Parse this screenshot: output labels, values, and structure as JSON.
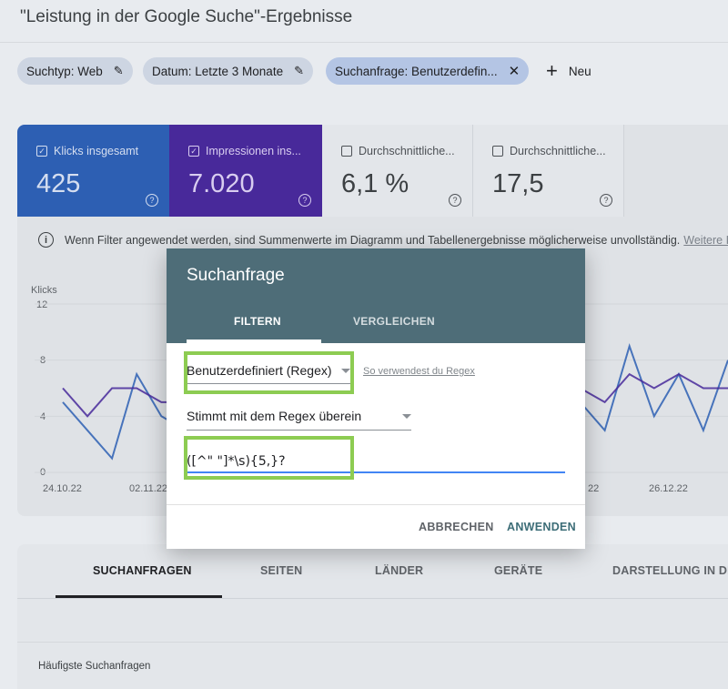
{
  "page": {
    "title": "\"Leistung in der Google Suche\"-Ergebnisse"
  },
  "filters": {
    "chips": [
      {
        "label": "Suchtyp: Web"
      },
      {
        "label": "Datum: Letzte 3 Monate"
      },
      {
        "label": "Suchanfrage: Benutzerdefin..."
      }
    ],
    "new_label": "Neu"
  },
  "metrics": [
    {
      "label": "Klicks insgesamt",
      "value": "425",
      "checked": true,
      "color": "#2d5fb3"
    },
    {
      "label": "Impressionen ins...",
      "value": "7.020",
      "checked": true,
      "color": "#48299a"
    },
    {
      "label": "Durchschnittliche...",
      "value": "6,1 %",
      "checked": false
    },
    {
      "label": "Durchschnittliche...",
      "value": "17,5",
      "checked": false
    }
  ],
  "info": {
    "text": "Wenn Filter angewendet werden, sind Summenwerte im Diagramm und Tabellenergebnisse möglicherweise unvollständig.",
    "link": "Weitere Inform"
  },
  "chart": {
    "ylabel": "Klicks",
    "yticks": [
      "12",
      "8",
      "4",
      "0"
    ],
    "xticks": [
      "24.10.22",
      "02.11.22",
      "22",
      "26.12.22"
    ]
  },
  "chart_data": {
    "type": "line",
    "ylabel": "Klicks",
    "ylim": [
      0,
      12
    ],
    "yticks": [
      0,
      4,
      8,
      12
    ],
    "xticks": [
      "24.10.22",
      "02.11.22",
      "22",
      "26.12.22"
    ],
    "series": [
      {
        "color": "#2d5fb3",
        "values": [
          5,
          3,
          1,
          7,
          4,
          3,
          5,
          4,
          5,
          3,
          6,
          5,
          4,
          6,
          3,
          4,
          6,
          3,
          7,
          4,
          2,
          5,
          3,
          9,
          4,
          7,
          3,
          8
        ]
      },
      {
        "color": "#48299a",
        "values": [
          6,
          4,
          6,
          6,
          5,
          5,
          6,
          7,
          5,
          5,
          6,
          6,
          5,
          7,
          5,
          6,
          6,
          5,
          6,
          5,
          6,
          6,
          5,
          7,
          6,
          7,
          6,
          6
        ]
      }
    ]
  },
  "modal": {
    "title": "Suchanfrage",
    "tabs": [
      "FILTERN",
      "VERGLEICHEN"
    ],
    "match_type": "Benutzerdefiniert (Regex)",
    "regex_help_link": "So verwendest du Regex",
    "operator": "Stimmt mit dem Regex überein",
    "input_value": "([^\" \"]*\\s){5,}?",
    "cancel_label": "ABBRECHEN",
    "apply_label": "ANWENDEN",
    "highlight_color": "#8dcc52"
  },
  "bottom_tabs": [
    "SUCHANFRAGEN",
    "SEITEN",
    "LÄNDER",
    "GERÄTE",
    "DARSTELLUNG IN DEN"
  ],
  "table": {
    "section_label": "Häufigste Suchanfragen"
  }
}
